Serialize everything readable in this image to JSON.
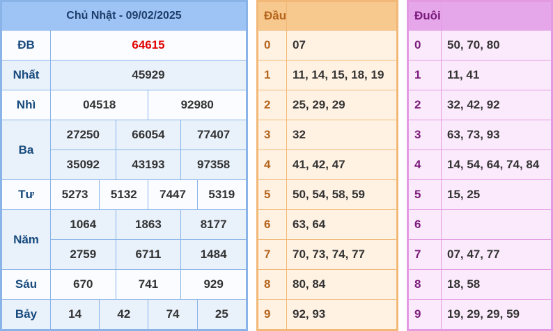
{
  "results": {
    "title": "Chủ Nhật - 09/02/2025",
    "db_label": "ĐB",
    "db": "64615",
    "nhat_label": "Nhất",
    "nhat": "45929",
    "nhi_label": "Nhì",
    "nhi": [
      "04518",
      "92980"
    ],
    "ba_label": "Ba",
    "ba": [
      "27250",
      "66054",
      "77407",
      "35092",
      "43193",
      "97358"
    ],
    "tu_label": "Tư",
    "tu": [
      "5273",
      "5132",
      "7447",
      "5319"
    ],
    "nam_label": "Năm",
    "nam": [
      "1064",
      "1863",
      "8177",
      "2759",
      "6711",
      "1484"
    ],
    "sau_label": "Sáu",
    "sau": [
      "670",
      "741",
      "929"
    ],
    "bay_label": "Bảy",
    "bay": [
      "14",
      "42",
      "74",
      "25"
    ]
  },
  "dau": {
    "title": "Đầu",
    "rows": [
      {
        "k": "0",
        "v": "07"
      },
      {
        "k": "1",
        "v": "11, 14, 15, 18, 19"
      },
      {
        "k": "2",
        "v": "25, 29, 29"
      },
      {
        "k": "3",
        "v": "32"
      },
      {
        "k": "4",
        "v": "41, 42, 47"
      },
      {
        "k": "5",
        "v": "50, 54, 58, 59"
      },
      {
        "k": "6",
        "v": "63, 64"
      },
      {
        "k": "7",
        "v": "70, 73, 74, 77"
      },
      {
        "k": "8",
        "v": "80, 84"
      },
      {
        "k": "9",
        "v": "92, 93"
      }
    ]
  },
  "duoi": {
    "title": "Đuôi",
    "rows": [
      {
        "k": "0",
        "v": "50, 70, 80"
      },
      {
        "k": "1",
        "v": "11, 41"
      },
      {
        "k": "2",
        "v": "32, 42, 92"
      },
      {
        "k": "3",
        "v": "63, 73, 93"
      },
      {
        "k": "4",
        "v": "14, 54, 64, 74, 84"
      },
      {
        "k": "5",
        "v": "15, 25"
      },
      {
        "k": "6",
        "v": ""
      },
      {
        "k": "7",
        "v": "07, 47, 77"
      },
      {
        "k": "8",
        "v": "18, 58"
      },
      {
        "k": "9",
        "v": "19, 29, 29, 59"
      }
    ]
  }
}
